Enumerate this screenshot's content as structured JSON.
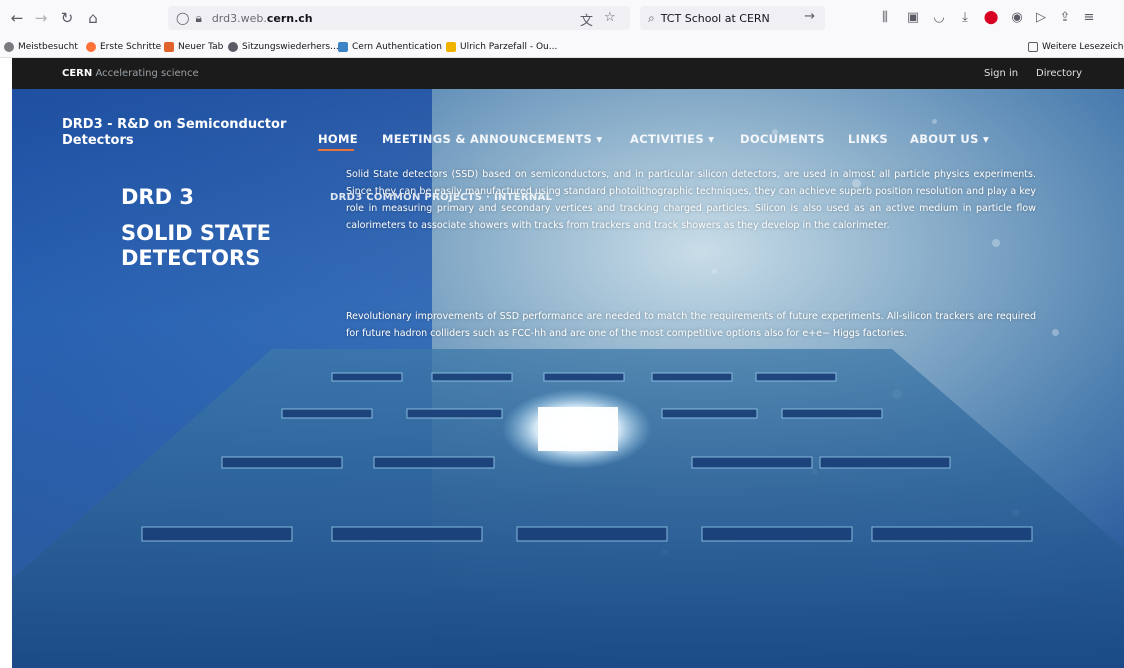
{
  "browser": {
    "url_prefix": "drd3.web.",
    "url_domain": "cern.ch",
    "search_query": "TCT School at CERN",
    "bookmarks": [
      "Meistbesucht",
      "Erste Schritte",
      "Neuer Tab",
      "Sitzungswiederhers...",
      "Cern Authentication",
      "Ulrich Parzefall - Ou...",
      "Weitere Lesezeichen"
    ]
  },
  "cern_bar": {
    "brand": "CERN",
    "tagline": "Accelerating science",
    "sign_in": "Sign in",
    "directory": "Directory"
  },
  "site": {
    "name": "DRD3 - R&D on Semiconductor Detectors",
    "nav": {
      "home": "HOME",
      "meetings": "MEETINGS & ANNOUNCEMENTS",
      "activities": "ACTIVITIES",
      "documents": "DOCUMENTS",
      "links": "LINKS",
      "about": "ABOUT US",
      "dropdown_glyph": "▾"
    },
    "subnav": "DRD3 COMMON PROJECTS · INTERNAL",
    "heading_1": "DRD 3",
    "heading_2": "SOLID STATE DETECTORS",
    "paragraph_1": "Solid State detectors (SSD) based on semiconductors, and in particular silicon detectors, are used in almost all particle physics experiments. Since they can be easily manufactured using standard photolithographic techniques, they can achieve superb position resolution and play a key role in measuring primary and secondary vertices and tracking charged particles. Silicon is also used as an active medium in particle flow calorimeters to associate showers with tracks from trackers and track showers as they develop in the calorimeter.",
    "paragraph_2": "Revolutionary improvements of SSD performance are needed to match the requirements of future experiments. All-silicon trackers are required for future hadron colliders such as FCC-hh and are one of the most competitive options also for e+e− Higgs factories."
  },
  "colors": {
    "cern_bar": "#1b1b1b",
    "nav_active_underline": "#e8743b",
    "hero_blue": "#25539a"
  }
}
